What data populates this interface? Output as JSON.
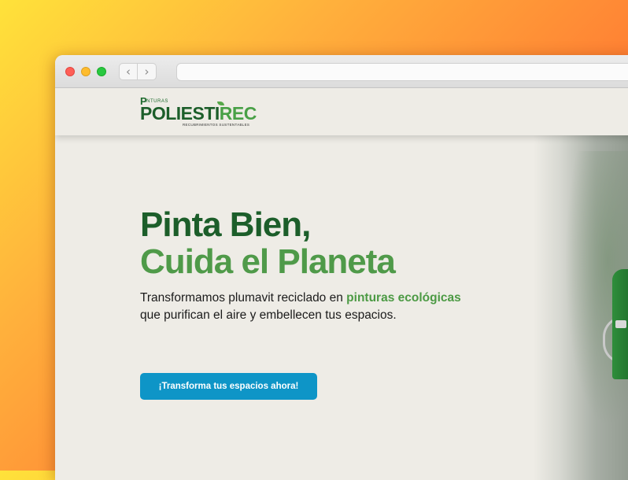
{
  "browser": {
    "url": "",
    "back_icon": "chevron-left-icon",
    "forward_icon": "chevron-right-icon",
    "back_glyph": "‹",
    "forward_glyph": "›"
  },
  "logo": {
    "prefix_letter": "P",
    "small_text": "INTURAS",
    "main_text": "POLIESTI",
    "accent_text": "REC",
    "tagline": "RECUBRIMIENTOS SUSTENTABLES"
  },
  "hero": {
    "title_line1": "Pinta Bien,",
    "title_line2": "Cuida el Planeta",
    "subtitle_before": "Transformamos plumavit reciclado en ",
    "subtitle_highlight": "pinturas ecológicas",
    "subtitle_after": "que purifican el aire y embellecen tus espacios.",
    "cta_label": "¡Transforma tus espacios ahora!"
  },
  "colors": {
    "dark_green": "#1c5e2a",
    "light_green": "#4f9a49",
    "cta_blue": "#0e95c7",
    "page_bg": "#eeece6"
  }
}
